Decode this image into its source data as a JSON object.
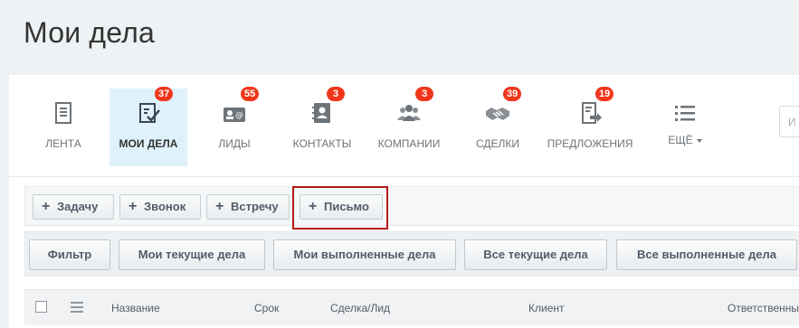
{
  "page": {
    "title": "Мои дела"
  },
  "nav": {
    "items": [
      {
        "label": "Лента",
        "badge": "",
        "icon": "feed-icon",
        "active": false
      },
      {
        "label": "Мои дела",
        "badge": "37",
        "icon": "tasks-check-icon",
        "active": true
      },
      {
        "label": "Лиды",
        "badge": "55",
        "icon": "leads-card-icon",
        "active": false
      },
      {
        "label": "Контакты",
        "badge": "3",
        "icon": "contacts-book-icon",
        "active": false
      },
      {
        "label": "Компании",
        "badge": "3",
        "icon": "companies-people-icon",
        "active": false
      },
      {
        "label": "Сделки",
        "badge": "39",
        "icon": "deals-handshake-icon",
        "active": false
      },
      {
        "label": "Предложения",
        "badge": "19",
        "icon": "quote-document-icon",
        "active": false
      },
      {
        "label": "Ещё",
        "badge": "",
        "icon": "more-list-icon",
        "active": false
      }
    ],
    "search_placeholder": "И"
  },
  "toolbar": {
    "buttons": [
      "Задачу",
      "Звонок",
      "Встречу",
      "Письмо"
    ]
  },
  "filters": {
    "buttons": [
      "Фильтр",
      "Мои текущие дела",
      "Мои выполненные дела",
      "Все текущие дела",
      "Все выполненные дела"
    ]
  },
  "table": {
    "columns": [
      "Название",
      "Срок",
      "Сделка/Лид",
      "Клиент",
      "Ответственный"
    ]
  },
  "colors": {
    "badge": "#f0371d",
    "active_tab": "#dff1fb",
    "highlight": "#b31b1b"
  }
}
